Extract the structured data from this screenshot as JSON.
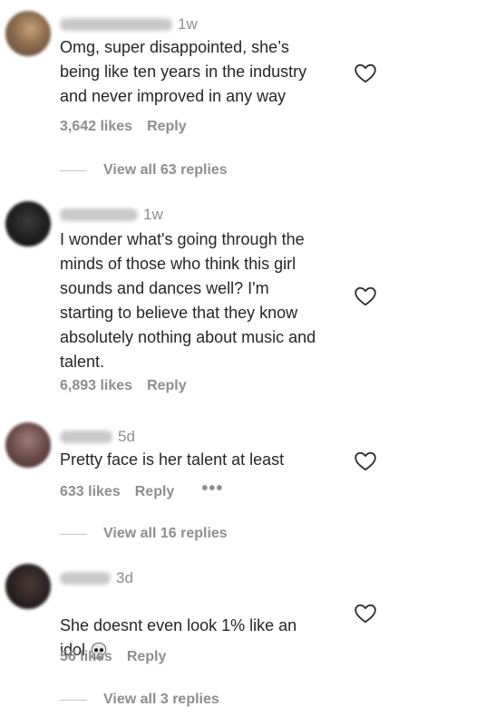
{
  "comments": [
    {
      "time": "1w",
      "text": "Omg, super disappointed, she’s\nbeing like ten years in the industry\nand never improved in any way",
      "likes": "3,642 likes",
      "reply_label": "Reply",
      "view_replies": "View all 63 replies"
    },
    {
      "time": "1w",
      "text": "I wonder what's going through the\nminds of those who think this girl\nsounds and dances well? I'm\nstarting to believe that they know\nabsolutely nothing about music and\ntalent.",
      "likes": "6,893 likes",
      "reply_label": "Reply"
    },
    {
      "time": "5d",
      "text": "Pretty face is her talent at least",
      "likes": "633 likes",
      "reply_label": "Reply",
      "more_label": "•••",
      "view_replies": "View all 16 replies"
    },
    {
      "time": "3d",
      "text": "She doesnt even look 1% like an\nidol",
      "likes": "56 likes",
      "reply_label": "Reply",
      "view_replies": "View all 3 replies",
      "emoji": "skull-emoji"
    }
  ],
  "colors": {
    "text": "#262626",
    "muted": "#8e8e8e",
    "divider": "#c7c7c7"
  },
  "icons": {
    "like": "heart-outline-icon",
    "more": "more-options-icon"
  }
}
